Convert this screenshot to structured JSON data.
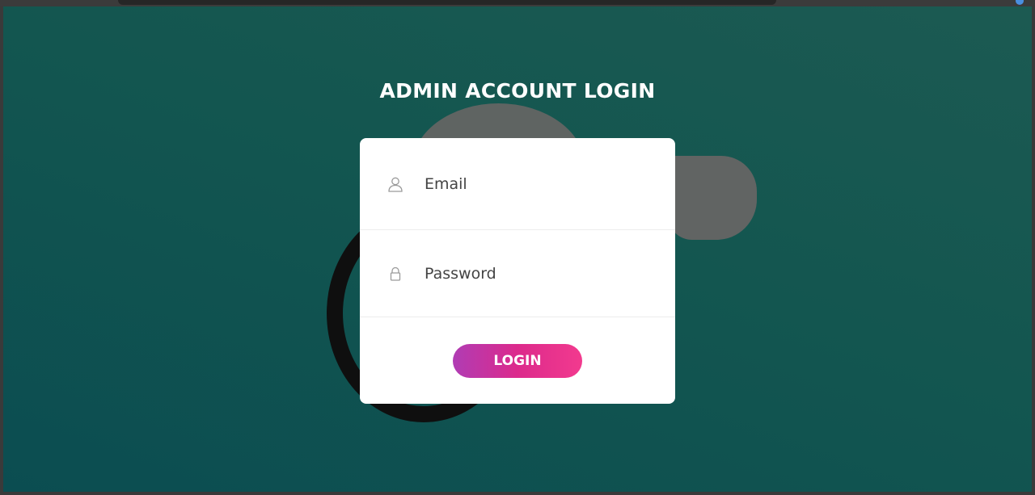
{
  "page": {
    "title": "ADMIN ACCOUNT LOGIN"
  },
  "form": {
    "email": {
      "placeholder": "Email",
      "value": "",
      "icon": "user-icon"
    },
    "password": {
      "placeholder": "Password",
      "value": "",
      "icon": "lock-icon"
    },
    "submit_label": "LOGIN"
  },
  "colors": {
    "background_top": "#1c5a52",
    "background_bottom": "#0b4d51",
    "button_start": "#b03cb4",
    "button_end": "#f23a8e",
    "card": "#ffffff"
  }
}
